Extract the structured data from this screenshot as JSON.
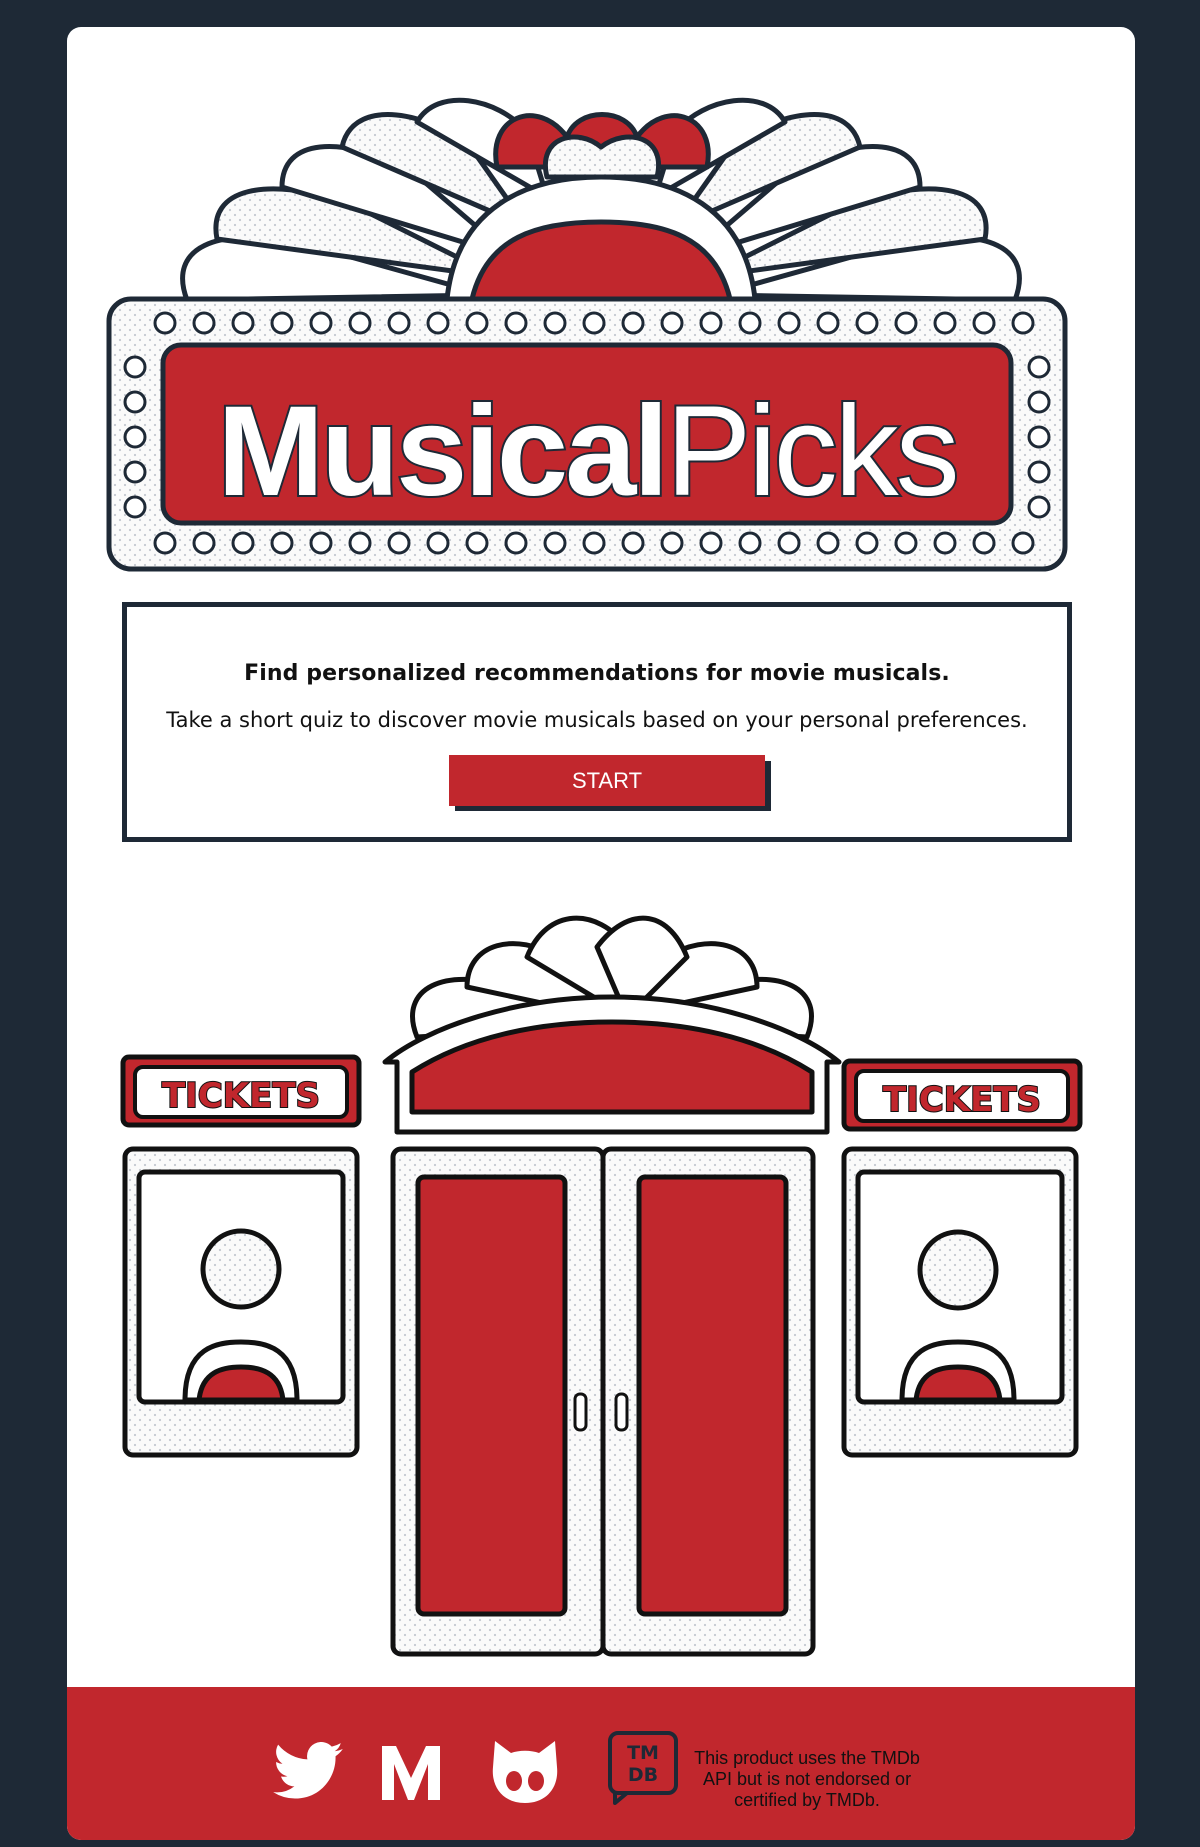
{
  "header": {
    "title_bold": "Musical",
    "title_light": "Picks"
  },
  "intro": {
    "heading": "Find personalized recommendations for movie musicals.",
    "text": "Take a short quiz to discover movie musicals based on your personal preferences.",
    "start_label": "START"
  },
  "theater": {
    "left_sign": "TICKETS",
    "right_sign": "TICKETS"
  },
  "footer": {
    "icons": [
      "twitter-icon",
      "medium-icon",
      "github-icon",
      "tmdb-logo"
    ],
    "tmdb_logo_top": "TM",
    "tmdb_logo_bottom": "DB",
    "tmdb_line1": "This product uses the TMDb",
    "tmdb_line2": "API but is not endorsed or",
    "tmdb_line3": "certified by TMDb."
  },
  "colors": {
    "background": "#1e2936",
    "card": "#ffffff",
    "accent_red": "#c1272d",
    "outline": "#1e2936"
  }
}
